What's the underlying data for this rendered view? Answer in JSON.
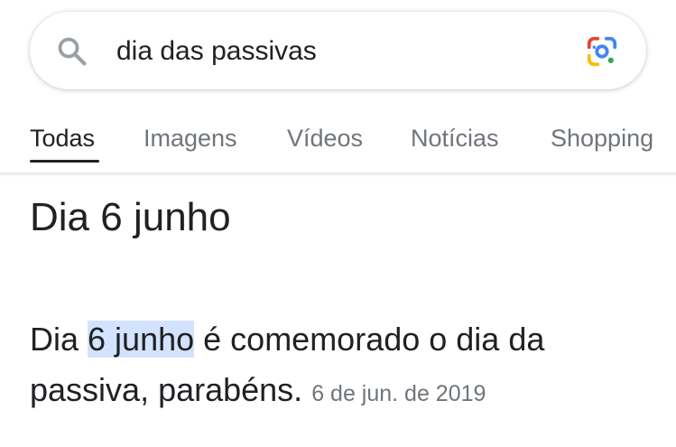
{
  "search": {
    "query": "dia das passivas",
    "search_icon": "search-icon",
    "lens_icon": "google-lens-icon"
  },
  "tabs": [
    {
      "label": "Todas",
      "active": true
    },
    {
      "label": "Imagens",
      "active": false
    },
    {
      "label": "Vídeos",
      "active": false
    },
    {
      "label": "Notícias",
      "active": false
    },
    {
      "label": "Shopping",
      "active": false
    }
  ],
  "answer": {
    "heading": "Dia 6 junho",
    "snippet_before": "Dia ",
    "snippet_highlight": "6 junho",
    "snippet_after": " é comemorado o dia da passiva, parabéns.",
    "date": "6 de jun. de 2019"
  },
  "colors": {
    "highlight": "#d3e3fd",
    "text": "#202124",
    "muted": "#70757a",
    "lens_blue": "#4285f4",
    "lens_red": "#ea4335",
    "lens_yellow": "#fbbc04",
    "lens_green": "#34a853"
  }
}
